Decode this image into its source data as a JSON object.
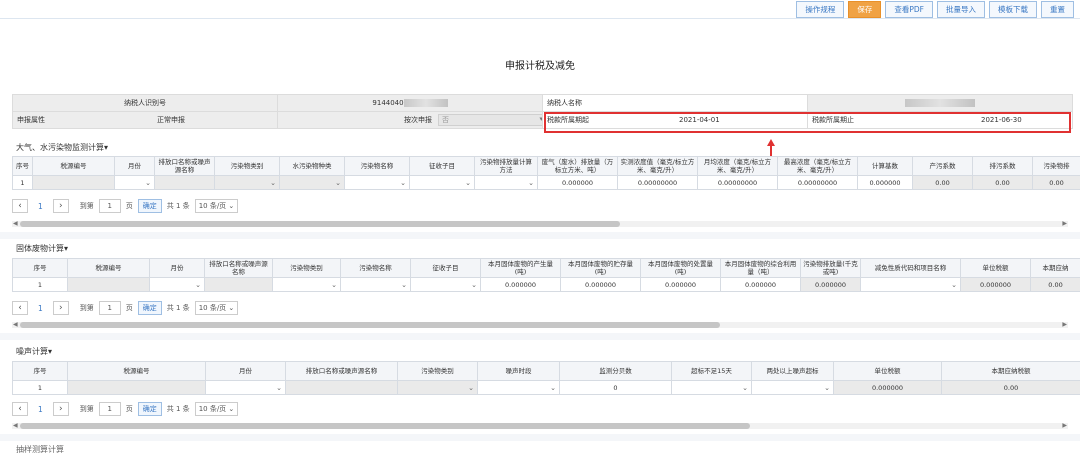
{
  "toolbar": {
    "buttons": [
      "操作规程",
      "保存",
      "查看PDF",
      "批量导入",
      "模板下载",
      "重置"
    ]
  },
  "page_title": "申报计税及减免",
  "info": {
    "taxpayer_id_label": "纳税人识别号",
    "taxpayer_id_value": "9144040",
    "taxpayer_name_label": "纳税人名称",
    "declare_attr_label": "申报属性",
    "declare_attr_value": "正常申报",
    "declare_by_label": "按次申报",
    "declare_by_value": "否",
    "period_start_label": "税款所属期起",
    "period_start_value": "2021-04-01",
    "period_end_label": "税款所属期止",
    "period_end_value": "2021-06-30"
  },
  "sec1": {
    "title": "大气、水污染物监测计算▾",
    "headers": [
      "序号",
      "税源编号",
      "月份",
      "排放口名称或噪声源名称",
      "污染物类别",
      "水污染物种类",
      "污染物名称",
      "征收子目",
      "污染物排放量计算方法",
      "废气（废水）排放量（万标立方米、吨）",
      "实测浓度值（毫克/标立方米、毫克/升）",
      "月均浓度（毫克/标立方米、毫克/升）",
      "最高浓度（毫克/标立方米、毫克/升）",
      "计算基数",
      "产污系数",
      "排污系数",
      "污染物排"
    ],
    "row": {
      "no": "1",
      "emission": "0.000000",
      "measured": "0.00000000",
      "avg": "0.00000000",
      "max": "0.00000000",
      "base": "0.000000",
      "produce": "0.00",
      "discharge": "0.00",
      "last": "0.00"
    }
  },
  "sec2": {
    "title": "固体废物计算▾",
    "headers": [
      "序号",
      "税源编号",
      "月份",
      "排放口名称或噪声源名称",
      "污染物类别",
      "污染物名称",
      "征收子目",
      "本月固体废物的产生量(吨)",
      "本月固体废物的贮存量(吨)",
      "本月固体废物的处置量(吨)",
      "本月固体废物的综合利用量（吨）",
      "污染物排放量(千克或吨)",
      "减免性质代码和项目名称",
      "单位税额",
      "本期应纳"
    ],
    "row": {
      "no": "1",
      "produced": "0.000000",
      "stored": "0.000000",
      "disposed": "0.000000",
      "utilized": "0.000000",
      "emission": "0.000000",
      "unit_tax": "0.000000",
      "payable": "0.00"
    }
  },
  "sec3": {
    "title": "噪声计算▾",
    "headers": [
      "序号",
      "税源编号",
      "月份",
      "排放口名称或噪声源名称",
      "污染物类别",
      "噪声时段",
      "监测分贝数",
      "超标不足15天",
      "两处以上噪声超标",
      "单位税额",
      "本期应纳税额"
    ],
    "row": {
      "no": "1",
      "decibel": "0",
      "unit_tax": "0.000000",
      "payable": "0.00"
    }
  },
  "pager": {
    "prev": "‹",
    "next": "›",
    "page": "1",
    "goto_label": "到第",
    "goto_value": "1",
    "page_unit": "页",
    "confirm": "确定",
    "total": "共 1 条",
    "size": "10 条/页"
  },
  "sec4": {
    "title": "抽样测算计算"
  }
}
